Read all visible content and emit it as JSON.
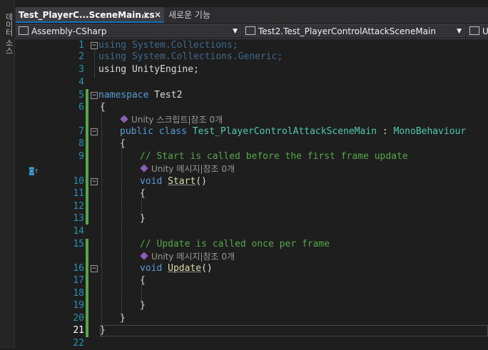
{
  "sidebar": {
    "label": "데이터 소스"
  },
  "tabs": [
    {
      "label": "Test_PlayerC...SceneMain.cs",
      "active": true,
      "pin": "⊹",
      "close": "✕"
    },
    {
      "label": "새로운 기능",
      "active": false
    }
  ],
  "navbar": {
    "project": "Assembly-CSharp",
    "class": "Test2.Test_PlayerControlAttackSceneMain",
    "member": "U"
  },
  "code": {
    "l1": "using System.Collections;",
    "l2": "using System.Collections.Generic;",
    "l3": "using UnityEngine;",
    "ns_kw": "namespace",
    "ns_name": " Test2",
    "brace_open": "{",
    "brace_close": "}",
    "lens_class": "Unity 스크립트|참조 0개",
    "class_kw": "public class ",
    "class_name": "Test_PlayerControlAttackSceneMain",
    "class_sep": " : ",
    "class_base": "MonoBehaviour",
    "c1": "// Start is called before the first frame update",
    "lens_start": "Unity 메시지|참조 0개",
    "void_kw": "void ",
    "start_fn": "Start",
    "parens": "()",
    "c2": "// Update is called once per frame",
    "lens_update": "Unity 메시지|참조 0개",
    "update_fn": "Update"
  },
  "line_numbers": [
    "1",
    "2",
    "3",
    "4",
    "5",
    "6",
    "7",
    "8",
    "9",
    "10",
    "11",
    "12",
    "13",
    "14",
    "15",
    "16",
    "17",
    "18",
    "19",
    "20",
    "21",
    "22"
  ],
  "colors": {
    "keyword": "#569cd6",
    "type": "#4ec9b0",
    "comment": "#57a64a",
    "line_number": "#2b91af",
    "change_bar": "#57a64a"
  }
}
